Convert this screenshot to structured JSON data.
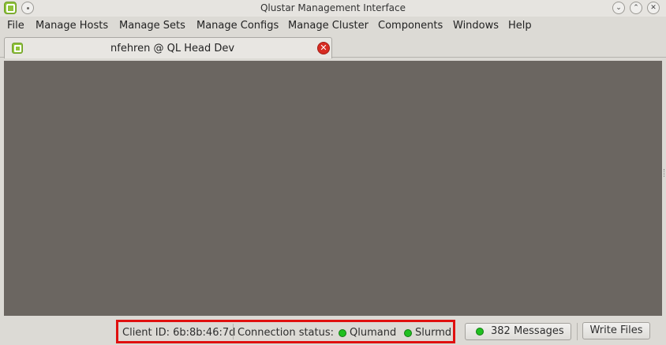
{
  "window": {
    "title": "Qlustar Management Interface",
    "min_glyph": "⌄",
    "max_glyph": "⌃",
    "close_glyph": "✕"
  },
  "menu": {
    "items": [
      "File",
      "Manage Hosts",
      "Manage Sets",
      "Manage Configs",
      "Manage Cluster",
      "Components",
      "Windows",
      "Help"
    ]
  },
  "tabs": [
    {
      "label": "nfehren @ QL Head Dev",
      "close_glyph": "✕",
      "icon": "qlustar-app-icon"
    }
  ],
  "status": {
    "client_id": "Client ID: 6b:8b:46:7d",
    "connection_label": "Connection status:",
    "services": [
      "Qlumand",
      "Slurmd"
    ],
    "service_status_color": "#20c020"
  },
  "buttons": {
    "messages": "382 Messages",
    "write_files": "Write Files"
  },
  "colors": {
    "workspace": "#6b6661",
    "highlight": "#e0100f"
  }
}
